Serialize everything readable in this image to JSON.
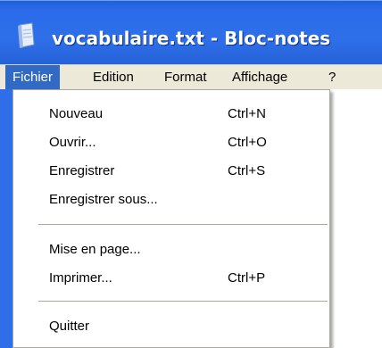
{
  "window": {
    "title": "vocabulaire.txt - Bloc-notes"
  },
  "menubar": {
    "items": [
      {
        "label": "Fichier"
      },
      {
        "label": "Edition"
      },
      {
        "label": "Format"
      },
      {
        "label": "Affichage"
      },
      {
        "label": "?"
      }
    ]
  },
  "file_menu": {
    "items": [
      {
        "label": "Nouveau",
        "shortcut": "Ctrl+N"
      },
      {
        "label": "Ouvrir...",
        "shortcut": "Ctrl+O"
      },
      {
        "label": "Enregistrer",
        "shortcut": "Ctrl+S"
      },
      {
        "label": "Enregistrer sous...",
        "shortcut": ""
      },
      {
        "label": "Mise en page...",
        "shortcut": ""
      },
      {
        "label": "Imprimer...",
        "shortcut": "Ctrl+P"
      },
      {
        "label": "Quitter",
        "shortcut": ""
      }
    ]
  },
  "colors": {
    "titlebar": "#2e6fe9",
    "menu_highlight": "#316ac5",
    "menubar_bg": "#ece9d8"
  },
  "icons": {
    "app": "notepad-icon"
  }
}
